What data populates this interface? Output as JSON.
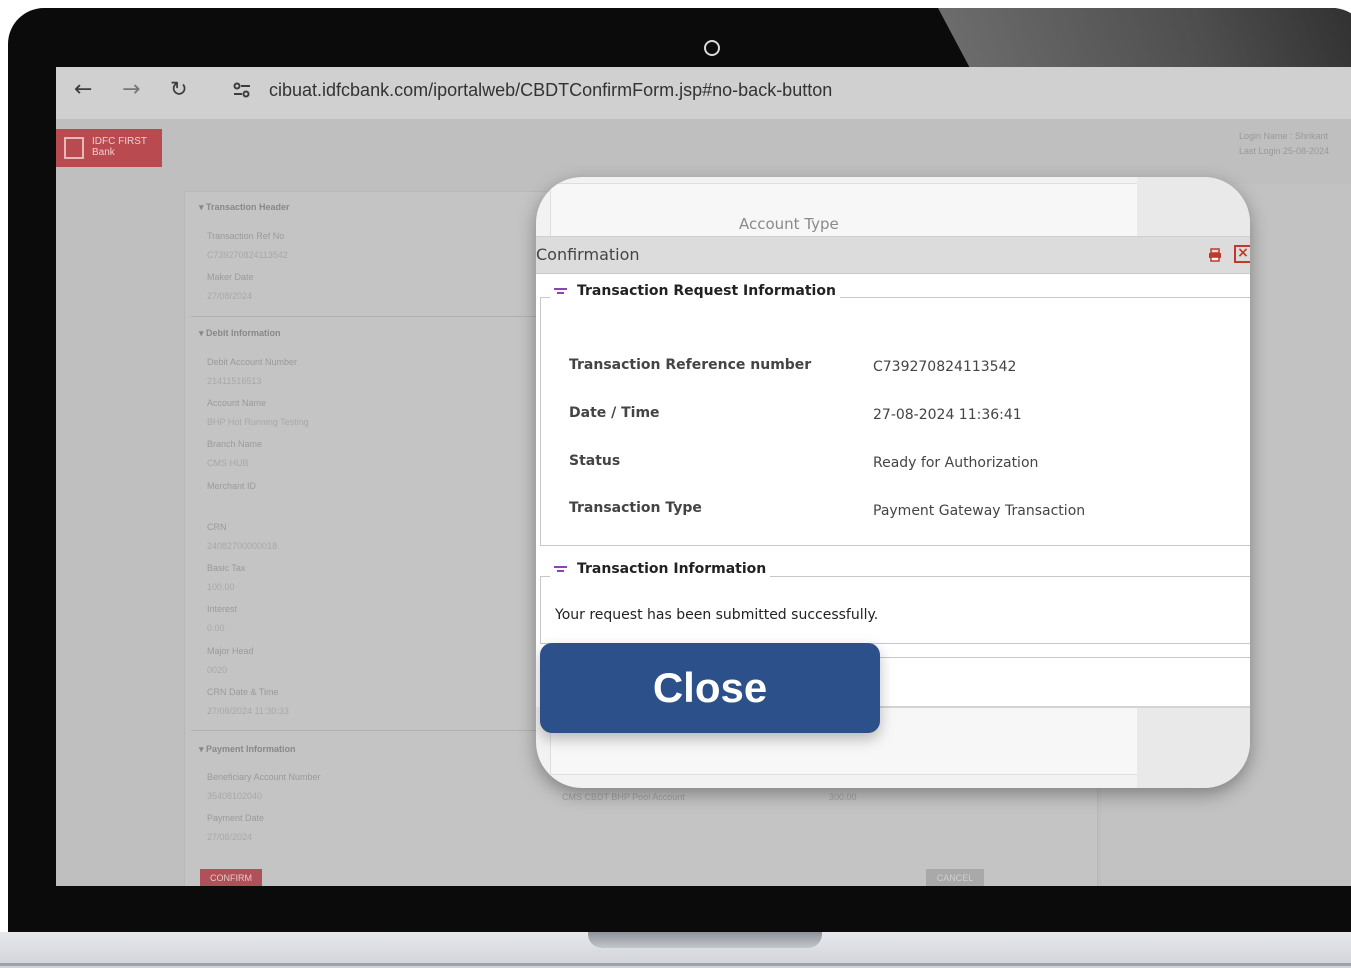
{
  "browser": {
    "back_icon": "arrow-left-icon",
    "forward_icon": "arrow-right-icon",
    "reload_icon": "reload-icon",
    "site_info_icon": "tune-icon",
    "url": "cibuat.idfcbank.com/iportalweb/CBDTConfirmForm.jsp#no-back-button"
  },
  "header": {
    "logo_line1": "IDFC FIRST",
    "logo_line2": "Bank",
    "login_name": "Login Name : Shrikant",
    "last_login": "Last Login    25-08-2024"
  },
  "background_form": {
    "transaction_header": "Transaction Header",
    "transaction_ref_label": "Transaction Ref No",
    "transaction_ref_value": "C739270824113542",
    "maker_date_label": "Maker Date",
    "maker_date_value": "27/08/2024",
    "debit_info": "Debit Information",
    "debit_account_label": "Debit Account Number",
    "debit_account_value": "21411516513",
    "account_name_label": "Account Name",
    "account_name_value": "BHP Hot Running Testing",
    "branch_name_label": "Branch Name",
    "branch_name_value": "CMS HUB",
    "merchant_id_label": "Merchant ID",
    "crn_label": "CRN",
    "crn_value": "24082700000018",
    "basic_tax_label": "Basic Tax",
    "basic_tax_value": "100.00",
    "interest_label": "Interest",
    "interest_value": "0.00",
    "major_head_label": "Major Head",
    "major_head_value": "0020",
    "crn_datetime_label": "CRN Date & Time",
    "crn_datetime_value": "27/08/2024 11:30:33",
    "payment_info": "Payment Information",
    "beneficiary_label": "Beneficiary Account Number",
    "beneficiary_value": "35408102040",
    "payment_date_label": "Payment Date",
    "payment_date_value": "27/08/2024",
    "payment_row_name": "CMS CBDT BHP Pool Account",
    "payment_row_amount": "300.00",
    "confirm_label": "CONFIRM",
    "cancel_label": "CANCEL"
  },
  "dialog": {
    "background_label": "Account Type",
    "title": "Confirmation",
    "print_icon": "printer-icon",
    "close_icon": "close-icon",
    "section1_title": "Transaction Request Information",
    "rows": [
      {
        "label": "Transaction Reference number",
        "value": "C739270824113542"
      },
      {
        "label": "Date / Time",
        "value": "27-08-2024 11:36:41"
      },
      {
        "label": "Status",
        "value": "Ready for Authorization"
      },
      {
        "label": "Transaction Type",
        "value": "Payment Gateway Transaction"
      }
    ],
    "section2_title": "Transaction Information",
    "success_message": "Your request has been submitted successfully.",
    "close_button": "Close"
  },
  "colors": {
    "accent_blue": "#2c5089",
    "brand_red": "#b94a50",
    "legend_icon": "#8e44ad"
  }
}
